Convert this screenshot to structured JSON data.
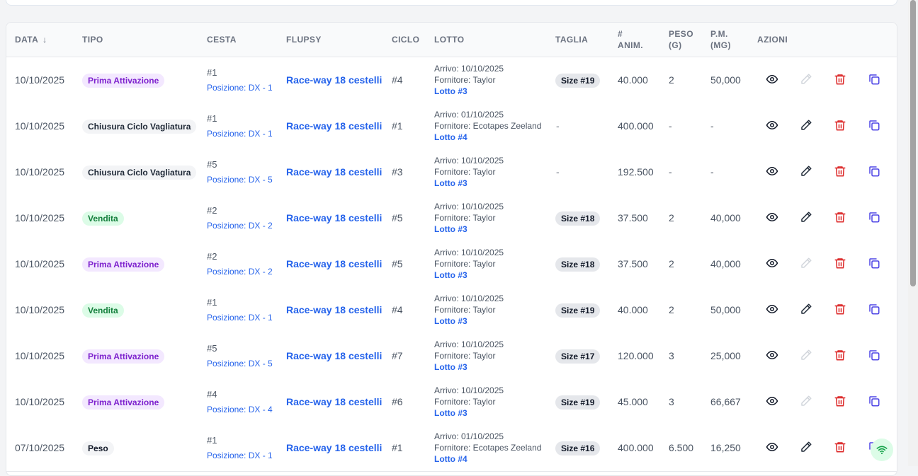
{
  "table": {
    "headers": {
      "data": "DATA",
      "tipo": "TIPO",
      "cesta": "CESTA",
      "flupsy": "FLUPSY",
      "ciclo": "CICLO",
      "lotto": "LOTTO",
      "taglia": "TAGLIA",
      "anim_1": "#",
      "anim_2": "ANIM.",
      "peso_1": "PESO",
      "peso_2": "(G)",
      "pm_1": "P.M.",
      "pm_2": "(MG)",
      "azioni": "AZIONI"
    },
    "sort_indicator": "↓",
    "rows": [
      {
        "data": "10/10/2025",
        "tipo": "Prima Attivazione",
        "tipo_style": "prima",
        "cesta": "#1",
        "posizione": "Posizione: DX - 1",
        "flupsy": "Race-way 18 cestelli",
        "ciclo": "#4",
        "arrivo": "Arrivo: 10/10/2025",
        "fornitore": "Fornitore: Taylor",
        "lotto": "Lotto #3",
        "taglia": "Size #19",
        "anim": "40.000",
        "peso": "2",
        "pm": "50,000",
        "edit_enabled": false
      },
      {
        "data": "10/10/2025",
        "tipo": "Chiusura Ciclo Vagliatura",
        "tipo_style": "chiusura",
        "cesta": "#1",
        "posizione": "Posizione: DX - 1",
        "flupsy": "Race-way 18 cestelli",
        "ciclo": "#1",
        "arrivo": "Arrivo: 01/10/2025",
        "fornitore": "Fornitore: Ecotapes Zeeland",
        "lotto": "Lotto #4",
        "taglia": "-",
        "anim": "400.000",
        "peso": "-",
        "pm": "-",
        "edit_enabled": true
      },
      {
        "data": "10/10/2025",
        "tipo": "Chiusura Ciclo Vagliatura",
        "tipo_style": "chiusura",
        "cesta": "#5",
        "posizione": "Posizione: DX - 5",
        "flupsy": "Race-way 18 cestelli",
        "ciclo": "#3",
        "arrivo": "Arrivo: 10/10/2025",
        "fornitore": "Fornitore: Taylor",
        "lotto": "Lotto #3",
        "taglia": "-",
        "anim": "192.500",
        "peso": "-",
        "pm": "-",
        "edit_enabled": true
      },
      {
        "data": "10/10/2025",
        "tipo": "Vendita",
        "tipo_style": "vendita",
        "cesta": "#2",
        "posizione": "Posizione: DX - 2",
        "flupsy": "Race-way 18 cestelli",
        "ciclo": "#5",
        "arrivo": "Arrivo: 10/10/2025",
        "fornitore": "Fornitore: Taylor",
        "lotto": "Lotto #3",
        "taglia": "Size #18",
        "anim": "37.500",
        "peso": "2",
        "pm": "40,000",
        "edit_enabled": true
      },
      {
        "data": "10/10/2025",
        "tipo": "Prima Attivazione",
        "tipo_style": "prima",
        "cesta": "#2",
        "posizione": "Posizione: DX - 2",
        "flupsy": "Race-way 18 cestelli",
        "ciclo": "#5",
        "arrivo": "Arrivo: 10/10/2025",
        "fornitore": "Fornitore: Taylor",
        "lotto": "Lotto #3",
        "taglia": "Size #18",
        "anim": "37.500",
        "peso": "2",
        "pm": "40,000",
        "edit_enabled": false
      },
      {
        "data": "10/10/2025",
        "tipo": "Vendita",
        "tipo_style": "vendita",
        "cesta": "#1",
        "posizione": "Posizione: DX - 1",
        "flupsy": "Race-way 18 cestelli",
        "ciclo": "#4",
        "arrivo": "Arrivo: 10/10/2025",
        "fornitore": "Fornitore: Taylor",
        "lotto": "Lotto #3",
        "taglia": "Size #19",
        "anim": "40.000",
        "peso": "2",
        "pm": "50,000",
        "edit_enabled": true
      },
      {
        "data": "10/10/2025",
        "tipo": "Prima Attivazione",
        "tipo_style": "prima",
        "cesta": "#5",
        "posizione": "Posizione: DX - 5",
        "flupsy": "Race-way 18 cestelli",
        "ciclo": "#7",
        "arrivo": "Arrivo: 10/10/2025",
        "fornitore": "Fornitore: Taylor",
        "lotto": "Lotto #3",
        "taglia": "Size #17",
        "anim": "120.000",
        "peso": "3",
        "pm": "25,000",
        "edit_enabled": false
      },
      {
        "data": "10/10/2025",
        "tipo": "Prima Attivazione",
        "tipo_style": "prima",
        "cesta": "#4",
        "posizione": "Posizione: DX - 4",
        "flupsy": "Race-way 18 cestelli",
        "ciclo": "#6",
        "arrivo": "Arrivo: 10/10/2025",
        "fornitore": "Fornitore: Taylor",
        "lotto": "Lotto #3",
        "taglia": "Size #19",
        "anim": "45.000",
        "peso": "3",
        "pm": "66,667",
        "edit_enabled": false
      },
      {
        "data": "07/10/2025",
        "tipo": "Peso",
        "tipo_style": "peso",
        "cesta": "#1",
        "posizione": "Posizione: DX - 1",
        "flupsy": "Race-way 18 cestelli",
        "ciclo": "#1",
        "arrivo": "Arrivo: 01/10/2025",
        "fornitore": "Fornitore: Ecotapes Zeeland",
        "lotto": "Lotto #4",
        "taglia": "Size #16",
        "anim": "400.000",
        "peso": "6.500",
        "pm": "16,250",
        "edit_enabled": true
      }
    ]
  },
  "icons": {
    "view": "eye-icon",
    "edit": "pencil-icon",
    "delete": "trash-icon",
    "copy": "copy-icon",
    "connection": "wifi-icon"
  },
  "colors": {
    "link": "#2563eb",
    "delete": "#dc2626",
    "copy": "#4f46e5",
    "prima_bg": "#f3e8ff",
    "prima_fg": "#7e22ce",
    "vendita_bg": "#dcfce7",
    "vendita_fg": "#15803d"
  }
}
